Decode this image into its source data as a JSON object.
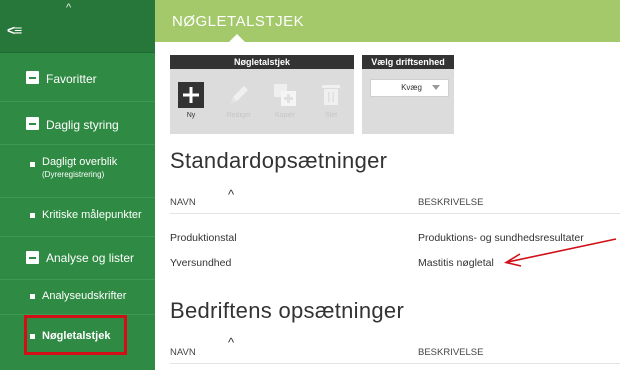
{
  "sidebar": {
    "collapse_caret": "^",
    "menu_glyph": "<≡",
    "items": [
      {
        "label": "Favoritter"
      },
      {
        "label": "Daglig styring"
      },
      {
        "label": "Dagligt overblik",
        "sublabel": "(Dyreregistrering)"
      },
      {
        "label": "Kritiske målepunkter"
      },
      {
        "label": "Analyse og lister"
      },
      {
        "label": "Analyseudskrifter"
      },
      {
        "label": "Nøgletalstjek"
      }
    ]
  },
  "header": {
    "title": "NØGLETALSTJEK"
  },
  "toolbar": {
    "group1_label": "Nøgletalstjek",
    "buttons": [
      {
        "label": "Ny",
        "icon": "plus-icon"
      },
      {
        "label": "Rediger",
        "icon": "pencil-icon"
      },
      {
        "label": "Kopiér",
        "icon": "copy-icon"
      },
      {
        "label": "Slet",
        "icon": "trash-icon"
      }
    ],
    "group2_label": "Vælg driftsenhed",
    "driftsenhed_value": "Kvæg"
  },
  "standard": {
    "heading": "Standardopsætninger",
    "col_name": "NAVN",
    "col_desc": "BESKRIVELSE",
    "rows": [
      {
        "name": "Produktionstal",
        "desc": "Produktions- og sundhedsresultater"
      },
      {
        "name": "Yversundhed",
        "desc": "Mastitis nøgletal"
      }
    ]
  },
  "bedrift": {
    "heading": "Bedriftens opsætninger",
    "col_name": "NAVN",
    "col_desc": "BESKRIVELSE"
  },
  "colors": {
    "sidebar": "#2f8a43",
    "header": "#a3c96a",
    "highlight": "#d10f17"
  }
}
